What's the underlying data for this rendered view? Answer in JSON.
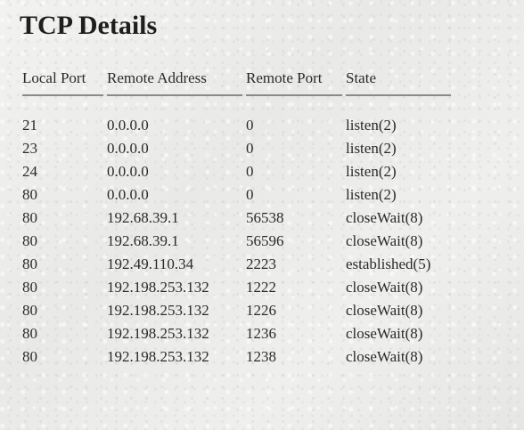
{
  "page": {
    "title": "TCP Details"
  },
  "table": {
    "headers": [
      "Local Port",
      "Remote Address",
      "Remote Port",
      "State"
    ],
    "rows": [
      [
        "21",
        "0.0.0.0",
        "0",
        "listen(2)"
      ],
      [
        "23",
        "0.0.0.0",
        "0",
        "listen(2)"
      ],
      [
        "24",
        "0.0.0.0",
        "0",
        "listen(2)"
      ],
      [
        "80",
        "0.0.0.0",
        "0",
        "listen(2)"
      ],
      [
        "80",
        "192.68.39.1",
        "56538",
        "closeWait(8)"
      ],
      [
        "80",
        "192.68.39.1",
        "56596",
        "closeWait(8)"
      ],
      [
        "80",
        "192.49.110.34",
        "2223",
        "established(5)"
      ],
      [
        "80",
        "192.198.253.132",
        "1222",
        "closeWait(8)"
      ],
      [
        "80",
        "192.198.253.132",
        "1226",
        "closeWait(8)"
      ],
      [
        "80",
        "192.198.253.132",
        "1236",
        "closeWait(8)"
      ],
      [
        "80",
        "192.198.253.132",
        "1238",
        "closeWait(8)"
      ]
    ]
  },
  "colors": {
    "background": "#eeeeec",
    "text": "#222222",
    "header_rule": "#8a8a8a"
  }
}
